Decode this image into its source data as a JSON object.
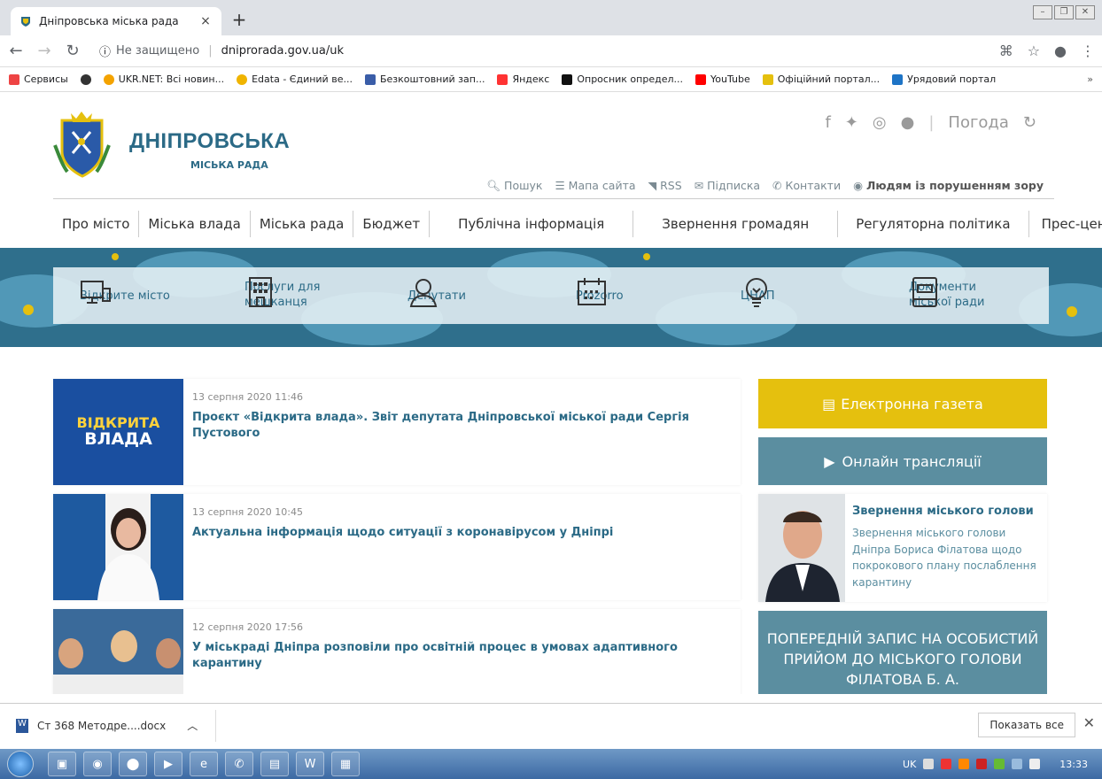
{
  "browser": {
    "tab_title": "Дніпровська міська рада",
    "tab_close": "×",
    "new_tab": "+",
    "insecure_label": "Не защищено",
    "url": "dniprorada.gov.ua/uk",
    "bookmarks": [
      "Сервисы",
      "UKR.NET: Всі новин...",
      "Edata - Єдиний ве...",
      "Безкоштовний зап...",
      "Яндекс",
      "Опросник определ...",
      "YouTube",
      "Офіційний портал...",
      "Урядовий портал"
    ],
    "bookmarks_more": "»"
  },
  "site": {
    "brand_line1": "ДНІПРОВСЬКА",
    "brand_line2": "МІСЬКА РАДА",
    "weather": "Погода",
    "util_links": [
      "Пошук",
      "Мапа сайта",
      "RSS",
      "Підписка",
      "Контакти"
    ],
    "util_accessibility": "Людям із порушенням зору",
    "nav": [
      "Про місто",
      "Міська влада",
      "Міська рада",
      "Бюджет",
      "Публічна інформація",
      "Звернення громадян",
      "Регуляторна політика",
      "Прес-центр"
    ],
    "quick": [
      {
        "label": "Відкрите місто"
      },
      {
        "label": "Послуги для мешканця"
      },
      {
        "label": "Депутати"
      },
      {
        "label": "Prozorro"
      },
      {
        "label": "ЦНАП"
      },
      {
        "label": "Документи міської ради"
      }
    ]
  },
  "news": [
    {
      "date": "13 серпня 2020 11:46",
      "title": "Проєкт «Відкрита влада». Звіт депутата Дніпровської міської ради Сергія Пустового",
      "thumb_text1": "ВІДКРИТА",
      "thumb_text2": "ВЛАДА"
    },
    {
      "date": "13 серпня 2020 10:45",
      "title": "Актуальна інформація щодо ситуації з коронавірусом у Дніпрі"
    },
    {
      "date": "12 серпня 2020 17:56",
      "title": "У міськраді Дніпра розповіли про освітній процес в умовах адаптивного карантину"
    }
  ],
  "sidebar": {
    "newspaper": "Електронна газета",
    "broadcast": "Онлайн трансляції",
    "mayor_title": "Звернення міського голови",
    "mayor_text": "Звернення міського голови Дніпра Бориса Філатова щодо покрокового плану послаблення карантину",
    "appointment": "ПОПЕРЕДНІЙ ЗАПИС НА ОСОБИСТИЙ ПРИЙОМ ДО МІСЬКОГО ГОЛОВИ ФІЛАТОВА Б. А."
  },
  "downloads": {
    "file": "Ст 368 Методре....docx",
    "show_all": "Показать все"
  },
  "taskbar": {
    "lang": "UK",
    "time": "13:33"
  },
  "colors": {
    "brand": "#2b6a86",
    "yellow": "#e5c00e",
    "teal": "#5b8ea0"
  }
}
